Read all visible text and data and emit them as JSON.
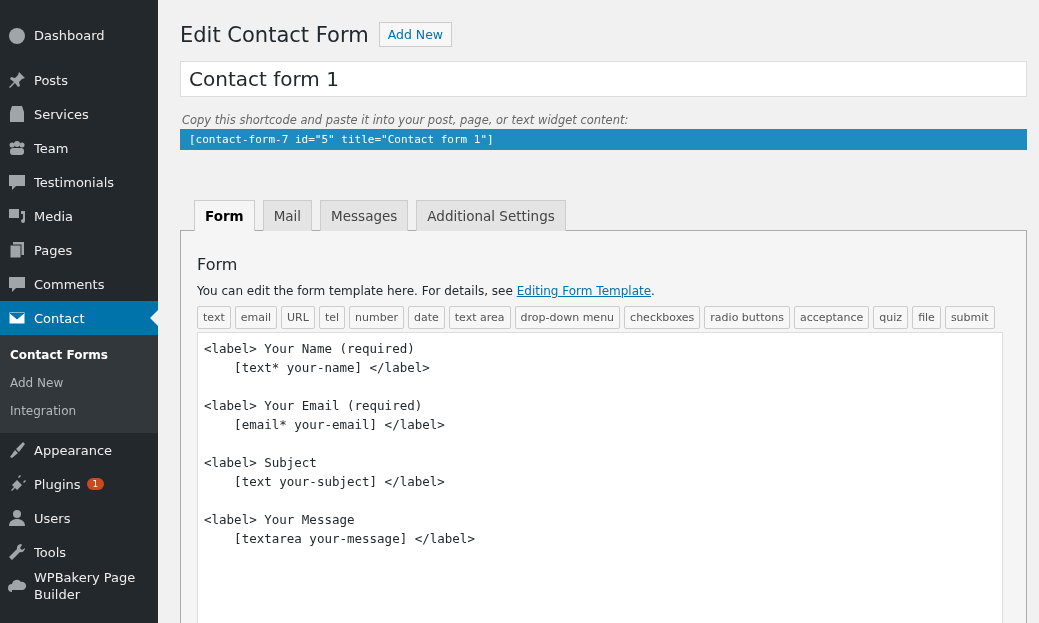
{
  "sidebar": {
    "groups": [
      [
        {
          "label": "Dashboard",
          "selected": false
        }
      ],
      [
        {
          "label": "Posts",
          "selected": false
        },
        {
          "label": "Services",
          "selected": false
        },
        {
          "label": "Team",
          "selected": false
        },
        {
          "label": "Testimonials",
          "selected": false
        },
        {
          "label": "Media",
          "selected": false
        },
        {
          "label": "Pages",
          "selected": false
        },
        {
          "label": "Comments",
          "selected": false
        },
        {
          "label": "Contact",
          "selected": true,
          "children": [
            {
              "label": "Contact Forms",
              "selected": true
            },
            {
              "label": "Add New",
              "selected": false
            },
            {
              "label": "Integration",
              "selected": false
            }
          ]
        },
        {
          "label": "Appearance",
          "selected": false
        },
        {
          "label": "Plugins",
          "selected": false,
          "badge": "1"
        },
        {
          "label": "Users",
          "selected": false
        },
        {
          "label": "Tools",
          "selected": false
        },
        {
          "label": "WPBakery Page Builder",
          "selected": false
        }
      ]
    ]
  },
  "page": {
    "title": "Edit Contact Form",
    "add_new": "Add New",
    "form_title": "Contact form 1",
    "shortcode_hint": "Copy this shortcode and paste it into your post, page, or text widget content:",
    "shortcode": "[contact-form-7 id=\"5\" title=\"Contact form 1\"]"
  },
  "tabs": [
    {
      "label": "Form",
      "selected": true
    },
    {
      "label": "Mail",
      "selected": false
    },
    {
      "label": "Messages",
      "selected": false
    },
    {
      "label": "Additional Settings",
      "selected": false
    }
  ],
  "panel": {
    "heading": "Form",
    "description": "You can edit the form template here. For details, see ",
    "link": "Editing Form Template",
    "description_end": ".",
    "tag_buttons": [
      "text",
      "email",
      "URL",
      "tel",
      "number",
      "date",
      "text area",
      "drop-down menu",
      "checkboxes",
      "radio buttons",
      "acceptance",
      "quiz",
      "file",
      "submit"
    ],
    "template_blocks": [
      [
        "<label> Your Name (required)",
        "    [text* your-name] </label>"
      ],
      [
        "<label> Your Email (required)",
        "    [email* your-email] </label>"
      ],
      [
        "<label> Subject",
        "    [text your-subject] </label>"
      ],
      [
        "<label> Your Message",
        "    [textarea your-message] </label>"
      ]
    ]
  }
}
